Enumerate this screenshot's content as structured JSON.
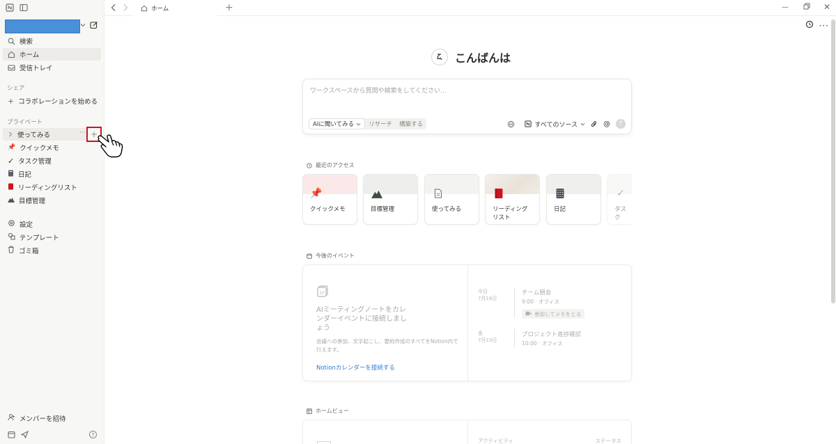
{
  "sidebar": {
    "items_top": [
      {
        "label": "検索",
        "icon": "search-icon"
      },
      {
        "label": "ホーム",
        "icon": "home-icon"
      },
      {
        "label": "受信トレイ",
        "icon": "inbox-icon"
      }
    ],
    "section_share": "シェア",
    "share_item": "コラボレーションを始める",
    "section_private": "プライベート",
    "private_items": [
      {
        "label": "使ってみる",
        "icon": "page-icon"
      },
      {
        "label": "クイックメモ",
        "icon": "pin-icon"
      },
      {
        "label": "タスク管理",
        "icon": "check-icon"
      },
      {
        "label": "日記",
        "icon": "notebook-icon"
      },
      {
        "label": "リーディングリスト",
        "icon": "book-icon"
      },
      {
        "label": "目標管理",
        "icon": "mountain-icon"
      }
    ],
    "bottom_items": [
      {
        "label": "設定",
        "icon": "gear-icon"
      },
      {
        "label": "テンプレート",
        "icon": "template-icon"
      },
      {
        "label": "ゴミ箱",
        "icon": "trash-icon"
      }
    ],
    "invite": "メンバーを招待",
    "add_button": "+",
    "more_button": "···",
    "help_icon": "?"
  },
  "topbar": {
    "tab_label": "ホーム",
    "add_tab": "+"
  },
  "main": {
    "greeting": "こんばんは",
    "ask": {
      "placeholder": "ワークスペースから質問や検索をしてください...",
      "modes": [
        "AIに聞いてみる",
        "リサーチ",
        "構築する"
      ],
      "source_label": "すべてのソース"
    },
    "recent": {
      "title": "最近のアクセス",
      "cards": [
        {
          "title": "クイックメモ",
          "icon": "pin-icon"
        },
        {
          "title": "目標管理",
          "icon": "mountain-icon"
        },
        {
          "title": "使ってみる",
          "icon": "page-icon"
        },
        {
          "title_line1": "リーディング",
          "title_line2": "リスト",
          "icon": "book-icon"
        },
        {
          "title": "日記",
          "icon": "notebook-icon"
        },
        {
          "title": "タスク",
          "icon": "check-icon"
        }
      ]
    },
    "events": {
      "title": "今後のイベント",
      "heading": "AIミーティングノートをカレンダーイベントに接続しましょう",
      "description": "会議への参加、文字起こし、要約作成のすべてをNotion内で行えます。",
      "link": "Notionカレンダーを接続する",
      "list": [
        {
          "day": "今日",
          "date": "7月18日",
          "name": "チーム朝会",
          "time": "9:00 · オフィス",
          "memo": "参加してメモをとる"
        },
        {
          "day": "金",
          "date": "7月19日",
          "name": "プロジェクト進捗確認",
          "time": "10:00 · オフィス"
        }
      ]
    },
    "homeview": {
      "title": "ホームビュー",
      "activity": "アクティビティ",
      "status": "ステータス"
    }
  },
  "colors": {
    "accent": "#2e7ad1",
    "highlight_box": "#d0141b",
    "workspace_bar": "#4a90d9"
  }
}
